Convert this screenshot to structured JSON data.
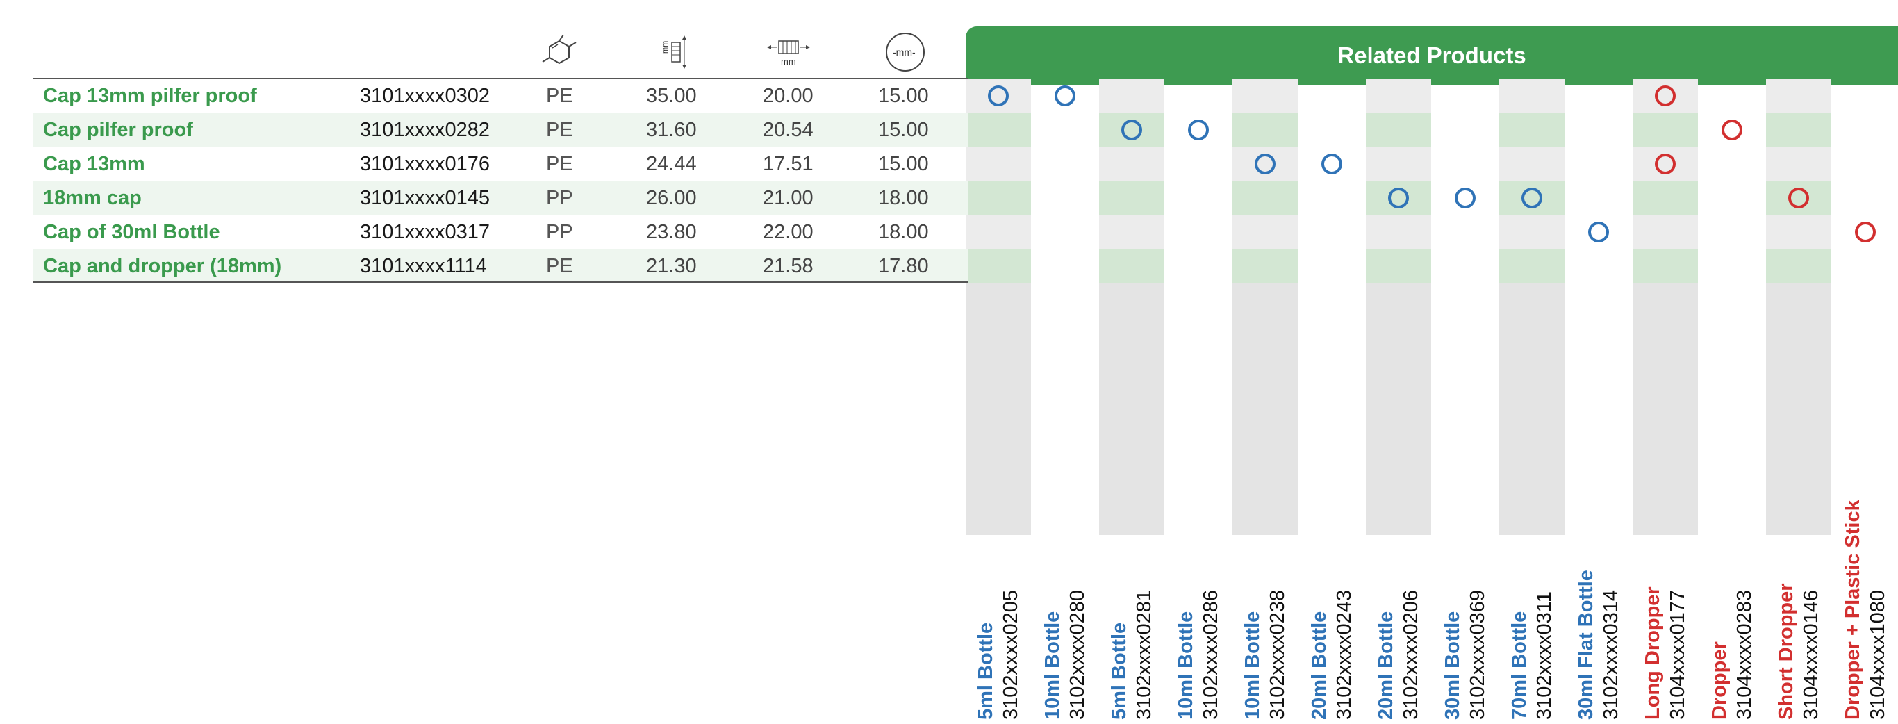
{
  "related_header": "Related Products",
  "header_icons": [
    {
      "name": "material-molecule-icon",
      "label": ""
    },
    {
      "name": "height-mm-icon",
      "label": "mm"
    },
    {
      "name": "width-mm-icon",
      "label": "mm"
    },
    {
      "name": "diameter-mm-icon",
      "label": "-mm-"
    }
  ],
  "caps": [
    {
      "name": "Cap 13mm pilfer proof",
      "code": "3101xxxx0302",
      "material": "PE",
      "height": "35.00",
      "width": "20.00",
      "diameter": "15.00"
    },
    {
      "name": "Cap pilfer proof",
      "code": "3101xxxx0282",
      "material": "PE",
      "height": "31.60",
      "width": "20.54",
      "diameter": "15.00"
    },
    {
      "name": "Cap 13mm",
      "code": "3101xxxx0176",
      "material": "PE",
      "height": "24.44",
      "width": "17.51",
      "diameter": "15.00"
    },
    {
      "name": "18mm cap",
      "code": "3101xxxx0145",
      "material": "PP",
      "height": "26.00",
      "width": "21.00",
      "diameter": "18.00"
    },
    {
      "name": "Cap of 30ml Bottle",
      "code": "3101xxxx0317",
      "material": "PP",
      "height": "23.80",
      "width": "22.00",
      "diameter": "18.00"
    },
    {
      "name": "Cap and dropper (18mm)",
      "code": "3101xxxx1114",
      "material": "PE",
      "height": "21.30",
      "width": "21.58",
      "diameter": "17.80"
    }
  ],
  "products": [
    {
      "name": "5ml Bottle",
      "code": "3102xxxx0205",
      "color": "blue"
    },
    {
      "name": "10ml Bottle",
      "code": "3102xxxx0280",
      "color": "blue"
    },
    {
      "name": "5ml Bottle",
      "code": "3102xxxx0281",
      "color": "blue"
    },
    {
      "name": "10ml Bottle",
      "code": "3102xxxx0286",
      "color": "blue"
    },
    {
      "name": "10ml Bottle",
      "code": "3102xxxx0238",
      "color": "blue"
    },
    {
      "name": "20ml Bottle",
      "code": "3102xxxx0243",
      "color": "blue"
    },
    {
      "name": "20ml Bottle",
      "code": "3102xxxx0206",
      "color": "blue"
    },
    {
      "name": "30ml Bottle",
      "code": "3102xxxx0369",
      "color": "blue"
    },
    {
      "name": "70ml Bottle",
      "code": "3102xxxx0311",
      "color": "blue"
    },
    {
      "name": "30ml Flat Bottle",
      "code": "3102xxxx0314",
      "color": "blue"
    },
    {
      "name": "Long Dropper",
      "code": "3104xxxx0177",
      "color": "red"
    },
    {
      "name": "Dropper",
      "code": "3104xxxx0283",
      "color": "red"
    },
    {
      "name": "Short Dropper",
      "code": "3104xxxx0146",
      "color": "red"
    },
    {
      "name": "Dropper + Plastic Stick",
      "code": "3104xxxx1080",
      "color": "red"
    }
  ],
  "compatibility": [
    [
      0,
      0
    ],
    [
      0,
      1
    ],
    [
      0,
      10
    ],
    [
      1,
      2
    ],
    [
      1,
      3
    ],
    [
      1,
      11
    ],
    [
      2,
      4
    ],
    [
      2,
      5
    ],
    [
      2,
      10
    ],
    [
      3,
      6
    ],
    [
      3,
      7
    ],
    [
      3,
      8
    ],
    [
      3,
      12
    ],
    [
      4,
      9
    ],
    [
      4,
      13
    ]
  ],
  "colors": {
    "brand_green": "#3e9b51",
    "bottle_blue": "#2f73b7",
    "dropper_red": "#d22f2f"
  }
}
